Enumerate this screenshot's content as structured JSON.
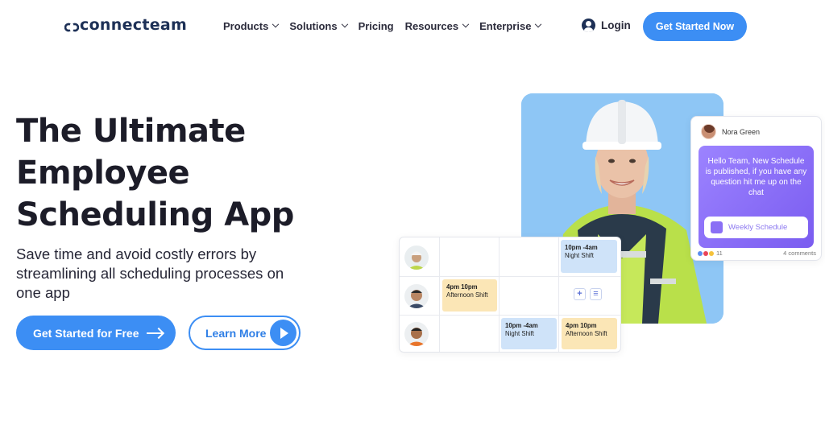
{
  "brand": {
    "name": "connecteam"
  },
  "nav": {
    "items": [
      {
        "label": "Products",
        "has_menu": true
      },
      {
        "label": "Solutions",
        "has_menu": true
      },
      {
        "label": "Pricing",
        "has_menu": false
      },
      {
        "label": "Resources",
        "has_menu": true
      },
      {
        "label": "Enterprise",
        "has_menu": true
      }
    ],
    "login": "Login",
    "cta": "Get Started Now"
  },
  "hero": {
    "title_lines": [
      "The Ultimate",
      "Employee",
      "Scheduling App"
    ],
    "subtitle": "Save time and avoid costly errors by streamlining all scheduling processes on one app",
    "primary_cta": "Get Started for Free",
    "secondary_cta": "Learn More"
  },
  "chat_card": {
    "author": "Nora Green",
    "message": "Hello Team, New Schedule is published, if you have any question hit me up on the chat",
    "attachment": "Weekly Schedule",
    "reaction_count": "11",
    "comments": "4 comments"
  },
  "schedule": {
    "shifts": [
      {
        "time": "10pm -4am",
        "name": "Night Shift",
        "color": "blue"
      },
      {
        "time": "4pm 10pm",
        "name": "Afternoon Shift",
        "color": "yellow"
      },
      {
        "time": "10pm -4am",
        "name": "Night Shift",
        "color": "blue"
      },
      {
        "time": "4pm 10pm",
        "name": "Afternoon Shift",
        "color": "yellow"
      }
    ],
    "add_icon": "+",
    "menu_icon": "≡"
  },
  "colors": {
    "accent": "#3c8ef4",
    "brand_dark": "#1d3056",
    "photo_bg": "#8ec6f5",
    "chat_purple": "#8a6ff5",
    "shift_blue": "#cfe3f9",
    "shift_yellow": "#fbe6b6"
  }
}
